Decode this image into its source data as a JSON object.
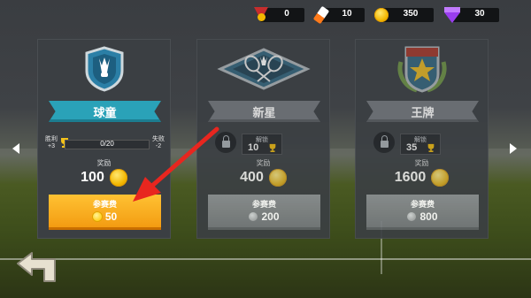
{
  "currencies": [
    {
      "icon": "medal-icon",
      "value": "0"
    },
    {
      "icon": "shuttlecock-icon",
      "value": "10"
    },
    {
      "icon": "coin-icon",
      "value": "350"
    },
    {
      "icon": "gem-icon",
      "value": "30"
    }
  ],
  "cards": [
    {
      "title": "球童",
      "status": "unlocked",
      "win_label": "胜利",
      "win_value": "+3",
      "progress_text": "0/20",
      "progress_fraction": 0,
      "loss_label": "失败",
      "loss_value": "-2",
      "reward_label": "奖励",
      "reward_amount": "100",
      "fee_label": "参赛费",
      "fee_amount": "50"
    },
    {
      "title": "新星",
      "status": "locked",
      "unlock_label": "解锁",
      "unlock_value": "10",
      "reward_label": "奖励",
      "reward_amount": "400",
      "fee_label": "参赛费",
      "fee_amount": "200"
    },
    {
      "title": "王牌",
      "status": "locked",
      "unlock_label": "解锁",
      "unlock_value": "35",
      "reward_label": "奖励",
      "reward_amount": "1600",
      "fee_label": "参赛费",
      "fee_amount": "800"
    }
  ],
  "colors": {
    "accent_teal": "#2aa2b8",
    "button_orange": "#f39c12",
    "arrow_red": "#e8261f",
    "coin_gold": "#f3b700",
    "gem_purple": "#9a3df0"
  }
}
